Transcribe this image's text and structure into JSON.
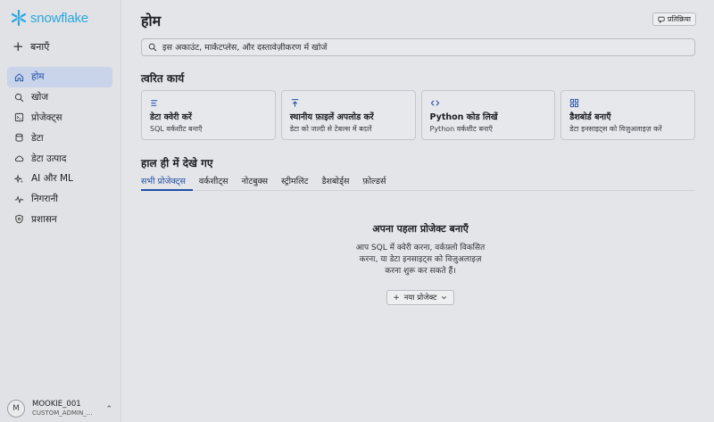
{
  "brand": {
    "name": "snowflake",
    "color": "#29a8e0"
  },
  "sidebar": {
    "create_label": "बनाएँ",
    "items": [
      {
        "label": "होम",
        "icon": "home-icon",
        "active": true
      },
      {
        "label": "खोज",
        "icon": "search-icon",
        "active": false
      },
      {
        "label": "प्रोजेक्ट्स",
        "icon": "projects-icon",
        "active": false
      },
      {
        "label": "डेटा",
        "icon": "database-icon",
        "active": false
      },
      {
        "label": "डेटा उत्पाद",
        "icon": "cloud-icon",
        "active": false
      },
      {
        "label": "AI और ML",
        "icon": "sparkle-icon",
        "active": false
      },
      {
        "label": "निगरानी",
        "icon": "activity-icon",
        "active": false
      },
      {
        "label": "प्रशासन",
        "icon": "shield-icon",
        "active": false
      }
    ],
    "user": {
      "initial": "M",
      "name": "MOOKIE_001",
      "role": "CUSTOM_ADMIN_..."
    }
  },
  "header": {
    "title": "होम",
    "feedback_label": "प्रतिक्रिया"
  },
  "search": {
    "placeholder": "इस अकाउंट, मार्केटप्लेस, और दस्तावेज़ीकरण में खोजें"
  },
  "quick_actions": {
    "title": "त्वरित कार्य",
    "cards": [
      {
        "title": "डेटा क्वेरी करें",
        "subtitle": "SQL वर्कशीट बनाएँ",
        "icon": "lines-icon"
      },
      {
        "title": "स्थानीय फ़ाइलें अपलोड करें",
        "subtitle": "डेटा को जल्दी से टेबल्स में बदलें",
        "icon": "upload-icon"
      },
      {
        "title": "Python कोड लिखें",
        "subtitle": "Python वर्कशीट बनाएँ",
        "icon": "code-icon"
      },
      {
        "title": "डैशबोर्ड बनाएँ",
        "subtitle": "डेटा इनसाइट्स को विज़ुअलाइज़ करें",
        "icon": "dashboard-icon"
      }
    ]
  },
  "recent": {
    "title": "हाल ही में देखे गए",
    "tabs": [
      "सभी प्रोजेक्ट्स",
      "वर्कशीट्स",
      "नोटबुक्स",
      "स्ट्रीमलिट",
      "डैशबोर्ड्स",
      "फ़ोल्डर्स"
    ],
    "empty_title": "अपना पहला प्रोजेक्ट बनाएँ",
    "empty_lines": [
      "आप SQL में क्वेरी करना, वर्कफ़्लो विकसित",
      "करना, या डेटा इनसाइट्स को विज़ुअलाइज़",
      "करना शुरू कर सकते हैं।"
    ],
    "new_project_label": "नया प्रोजेक्ट"
  },
  "colors": {
    "accent": "#1f4fa5",
    "active_bg": "#c9d4ea"
  }
}
